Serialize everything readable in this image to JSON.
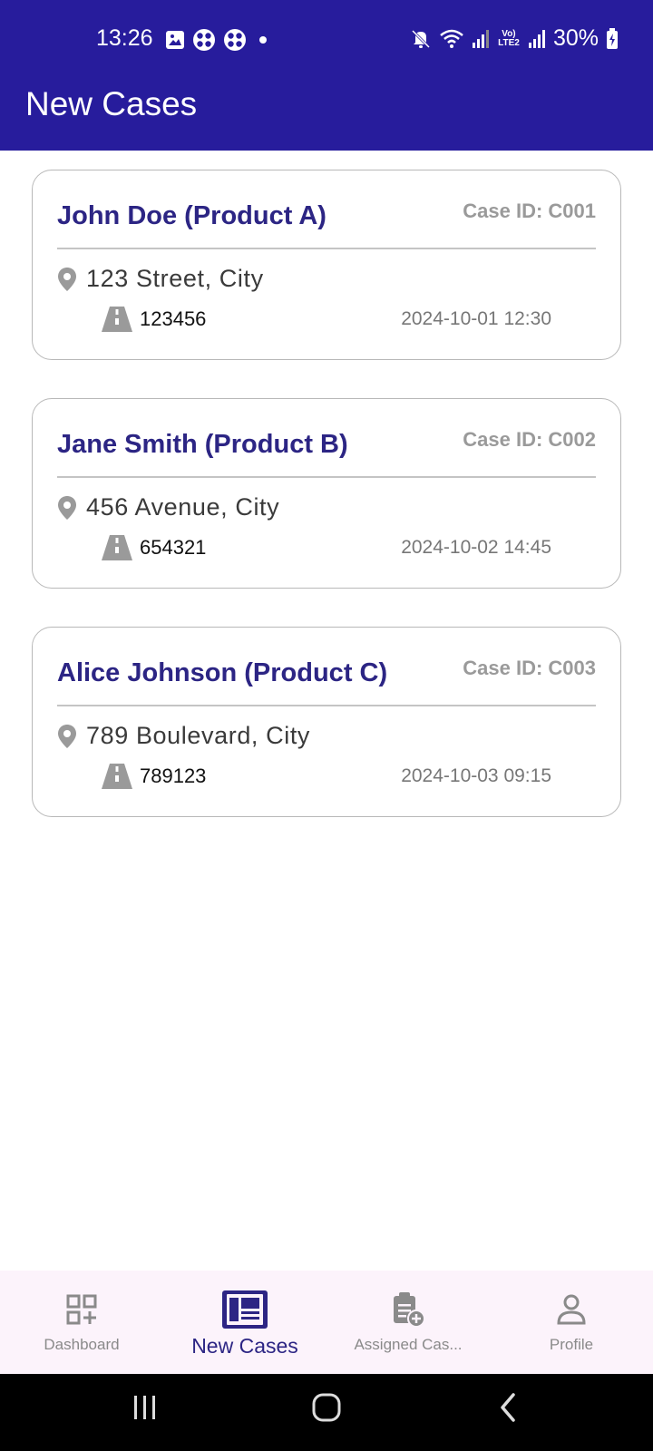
{
  "status_bar": {
    "time": "13:26",
    "battery": "30%",
    "network_label": "Vo) LTE2"
  },
  "app_bar": {
    "title": "New Cases"
  },
  "cases": [
    {
      "name": "John Doe (Product A)",
      "case_id": "Case ID: C001",
      "address": "123 Street, City",
      "pincode": "123456",
      "datetime": "2024-10-01 12:30"
    },
    {
      "name": "Jane Smith (Product B)",
      "case_id": "Case ID: C002",
      "address": "456 Avenue, City",
      "pincode": "654321",
      "datetime": "2024-10-02 14:45"
    },
    {
      "name": "Alice Johnson (Product C)",
      "case_id": "Case ID: C003",
      "address": "789 Boulevard, City",
      "pincode": "789123",
      "datetime": "2024-10-03 09:15"
    }
  ],
  "bottom_nav": {
    "items": [
      {
        "label": "Dashboard",
        "icon": "dashboard-icon"
      },
      {
        "label": "New Cases",
        "icon": "newspaper-icon",
        "active": true
      },
      {
        "label": "Assigned Cas...",
        "icon": "assigned-clipboard-icon"
      },
      {
        "label": "Profile",
        "icon": "person-icon"
      }
    ]
  },
  "colors": {
    "primary": "#271c9c",
    "title_text": "#2c2584",
    "muted": "#9a9a9a",
    "nav_bg": "#fcf3fb"
  }
}
